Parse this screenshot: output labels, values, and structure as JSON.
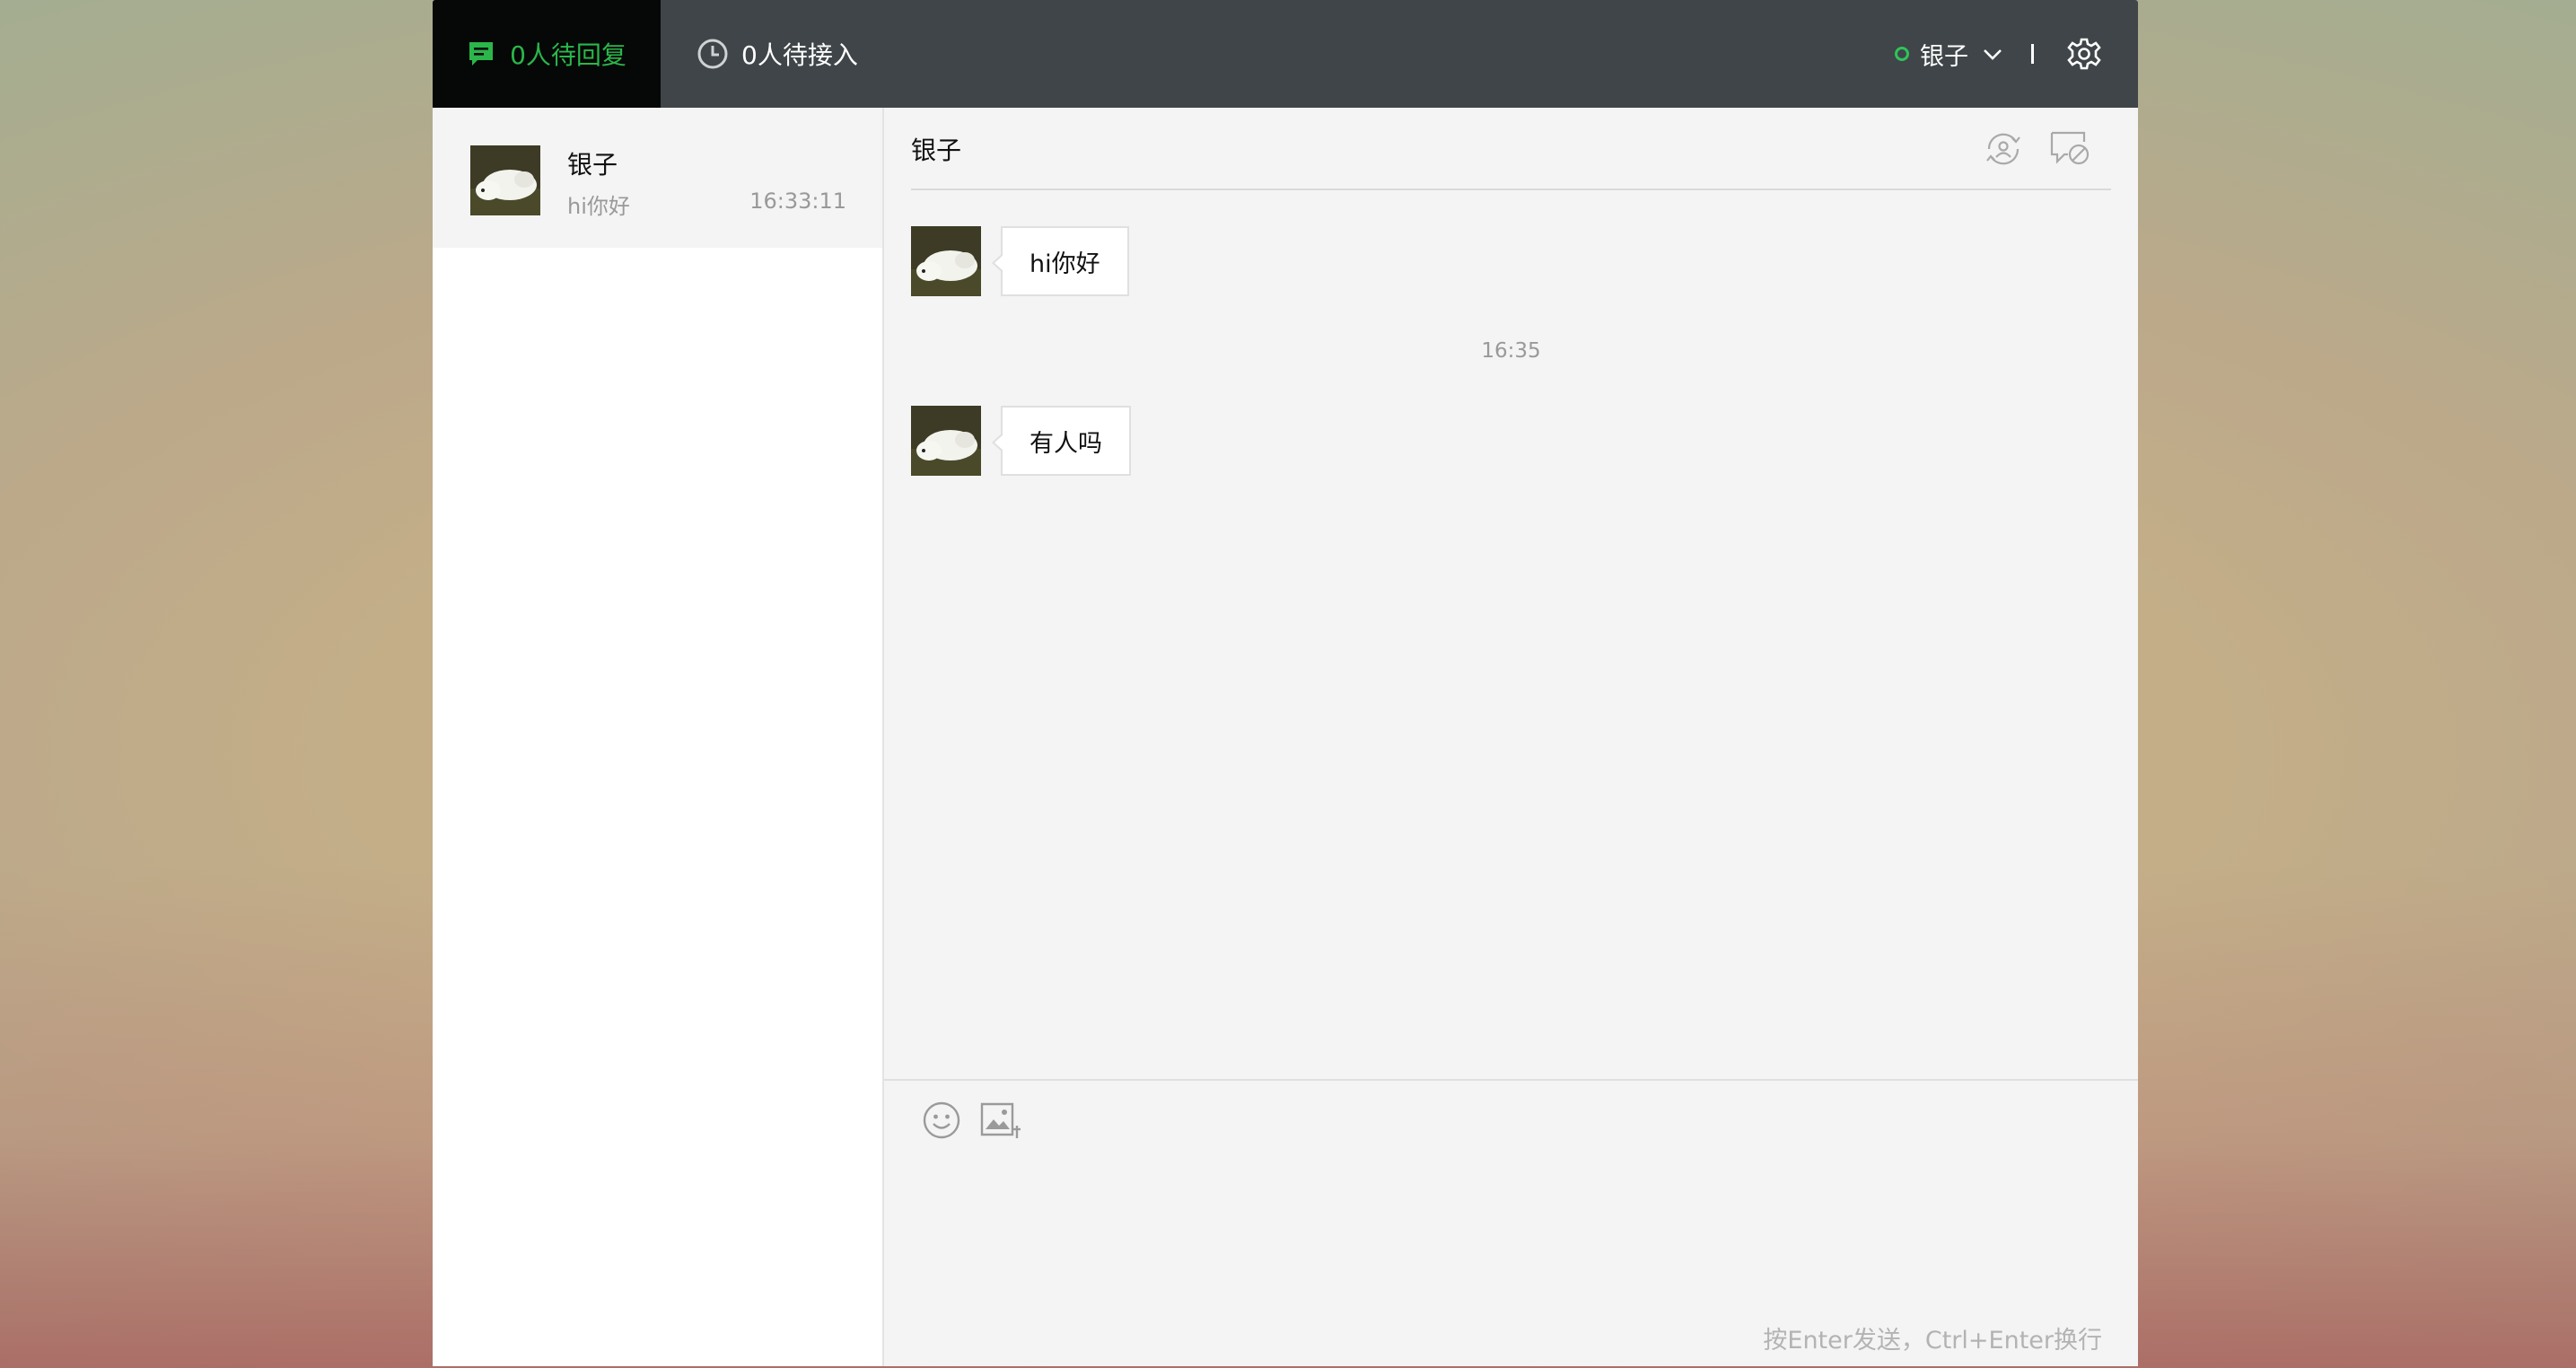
{
  "topbar": {
    "reply_tab_label": "0人待回复",
    "queue_tab_label": "0人待接入",
    "user_name": "银子",
    "status_color": "#2fc35a",
    "active_tab_color": "#2bb64a",
    "icons": [
      "chat-bubble-icon",
      "clock-icon",
      "chevron-down-icon",
      "gear-icon"
    ]
  },
  "sidebar": {
    "conversations": [
      {
        "name": "银子",
        "preview": "hi你好",
        "time": "16:33:11"
      }
    ]
  },
  "chat": {
    "title": "银子",
    "header_icons": [
      "transfer-user-icon",
      "close-chat-icon"
    ],
    "messages": [
      {
        "text": "hi你好"
      },
      {
        "text": "有人吗"
      }
    ],
    "timestamp": "16:35"
  },
  "composer": {
    "tools": [
      "emoji-icon",
      "image-upload-icon"
    ],
    "hint": "按Enter发送，Ctrl+Enter换行"
  }
}
